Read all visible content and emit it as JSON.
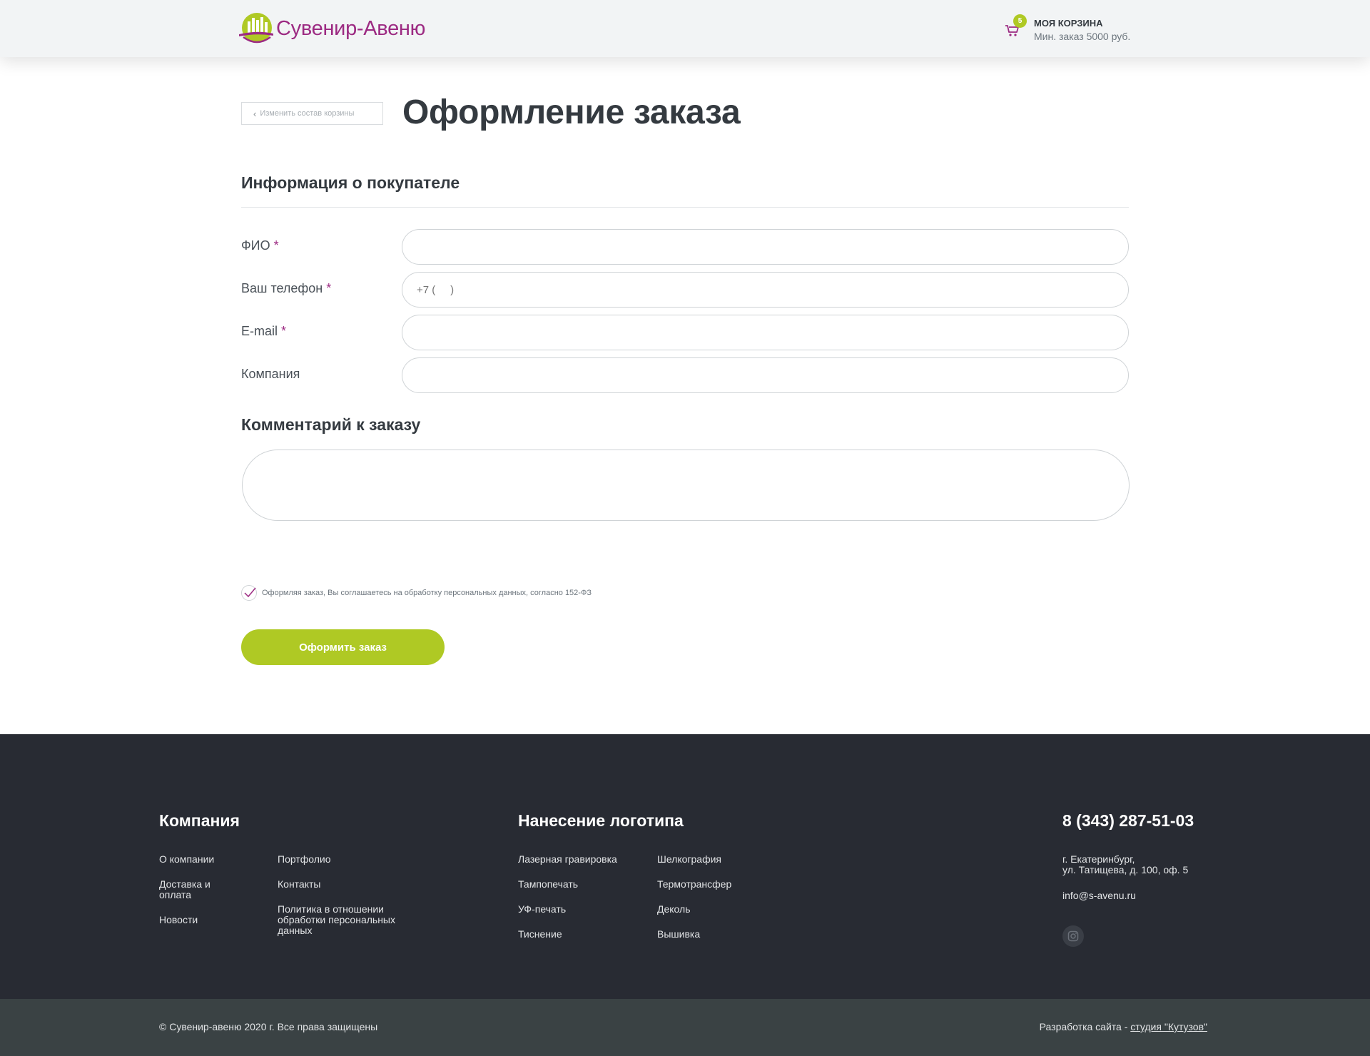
{
  "header": {
    "logo_text": "Сувенир-Авеню",
    "cart": {
      "badge_count": "5",
      "title": "МОЯ КОРЗИНА",
      "subtitle": "Мин. заказ 5000 руб."
    }
  },
  "main": {
    "back_button": "Изменить состав корзины",
    "page_title": "Оформление заказа",
    "buyer_section_title": "Информация о покупателе",
    "fields": [
      {
        "label": "ФИО",
        "required": "*",
        "value": "",
        "placeholder": ""
      },
      {
        "label": "Ваш телефон",
        "required": "*",
        "value": "",
        "placeholder": "+7 (     )"
      },
      {
        "label": "E-mail",
        "required": "*",
        "value": "",
        "placeholder": ""
      },
      {
        "label": "Компания",
        "required": "",
        "value": "",
        "placeholder": ""
      }
    ],
    "comment_section_title": "Комментарий к заказу",
    "comment_value": "",
    "agree_text": "Оформляя заказ, Вы соглашаетесь на обработку персональных данных, согласно 152-ФЗ",
    "submit_label": "Оформить заказ"
  },
  "footer": {
    "company": {
      "title": "Компания",
      "links": [
        "О компании",
        "Доставка и оплата",
        "Новости",
        "Портфолио",
        "Контакты",
        "Политика в отношении обработки персональных данных"
      ]
    },
    "logo_print": {
      "title": "Нанесение логотипа",
      "links": [
        "Лазерная гравировка",
        "Тампопечать",
        "УФ-печать",
        "Тиснение",
        "Шелкография",
        "Термотрансфер",
        "Деколь",
        "Вышивка"
      ]
    },
    "contacts": {
      "phone": "8 (343) 287-51-03",
      "address_line1": "г. Екатеринбург,",
      "address_line2": "ул. Татищева, д. 100, оф. 5",
      "email": "info@s-avenu.ru"
    },
    "copyright": "© Сувенир-авеню 2020 г.  Все права защищены",
    "dev_prefix": "Разработка сайта - ",
    "dev_link": "студия \"Кутузов\""
  },
  "colors": {
    "accent_green": "#afc924",
    "brand_purple": "#9c2a82",
    "footer_bg": "#282b33",
    "bottom_bar_bg": "#3a4244"
  },
  "icons": [
    "logo-icon",
    "cart-icon",
    "chevron-left-icon",
    "checkmark-icon",
    "instagram-icon"
  ]
}
